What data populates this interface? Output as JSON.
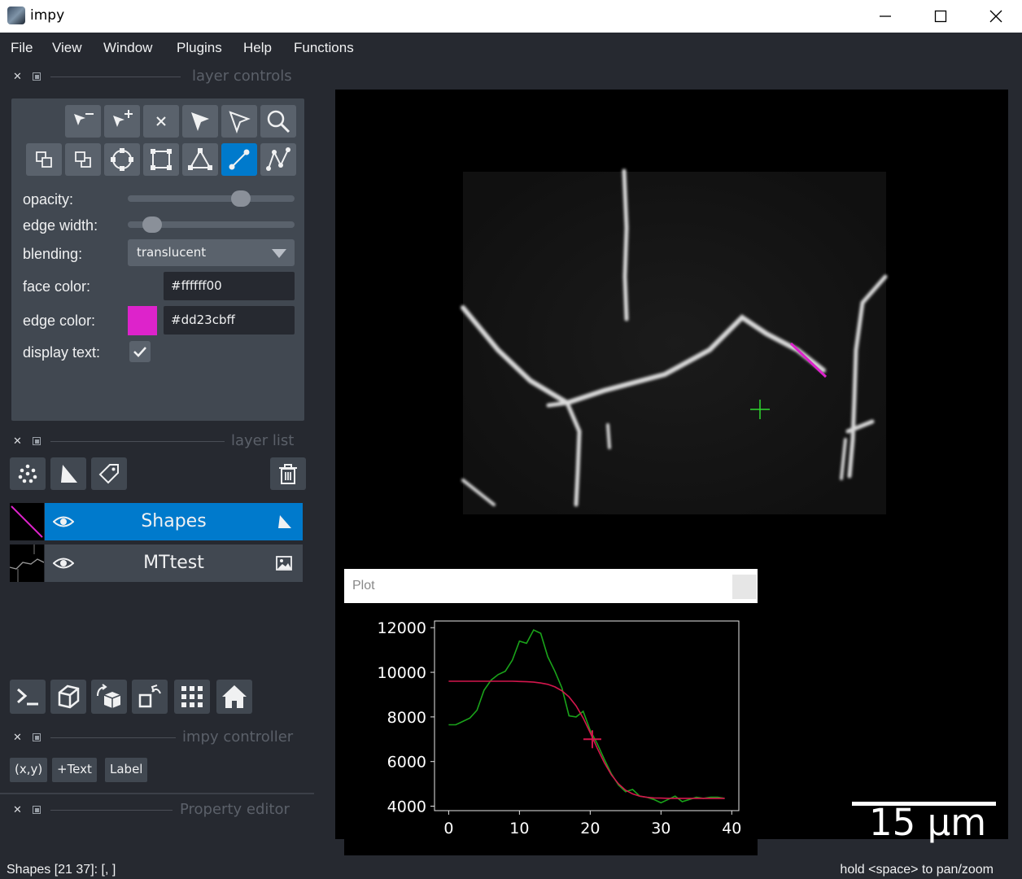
{
  "window": {
    "title": "impy"
  },
  "menu": [
    "File",
    "View",
    "Window",
    "Plugins",
    "Help",
    "Functions"
  ],
  "docks": {
    "layer_controls": "layer controls",
    "layer_list": "layer list",
    "impy_controller": "impy controller",
    "property_editor": "Property editor"
  },
  "controls": {
    "opacity_label": "opacity:",
    "opacity_value": 0.7,
    "edge_width_label": "edge width:",
    "edge_width_value": 0.1,
    "blending_label": "blending:",
    "blending_value": "translucent",
    "face_color_label": "face color:",
    "face_color_value": "#ffffff00",
    "edge_color_label": "edge color:",
    "edge_color_value": "#dd23cbff",
    "edge_color_swatch": "#dd23cb",
    "display_text_label": "display text:",
    "display_text_checked": true,
    "active_tool": "line-icon"
  },
  "layers": [
    {
      "name": "Shapes",
      "selected": true,
      "visible": true,
      "type": "shapes"
    },
    {
      "name": "MTtest",
      "selected": false,
      "visible": true,
      "type": "image"
    }
  ],
  "controller_buttons": [
    "(x,y)",
    "+Text",
    "Label"
  ],
  "scalebar": {
    "label": "15 µm"
  },
  "plot": {
    "title": "Plot",
    "chart_data": {
      "type": "line",
      "xlim": [
        -2,
        41
      ],
      "ylim": [
        3800,
        12300
      ],
      "xticks": [
        0,
        10,
        20,
        30,
        40
      ],
      "yticks": [
        4000,
        6000,
        8000,
        10000,
        12000
      ],
      "xtick_labels": [
        "0",
        "10",
        "20",
        "30",
        "40"
      ],
      "ytick_labels": [
        "4000",
        "6000",
        "8000",
        "10000",
        "12000"
      ],
      "series": [
        {
          "color": "#1aa31a",
          "x": [
            0,
            1,
            2,
            3,
            4,
            5,
            6,
            7,
            8,
            9,
            10,
            11,
            12,
            13,
            14,
            15,
            16,
            17,
            18,
            19,
            20,
            21,
            22,
            23,
            24,
            25,
            26,
            27,
            28,
            29,
            30,
            31,
            32,
            33,
            34,
            35,
            36,
            37,
            38,
            39
          ],
          "y": [
            7650,
            7650,
            7800,
            7950,
            8300,
            9200,
            9650,
            9900,
            10050,
            10550,
            11400,
            11300,
            11900,
            11750,
            10700,
            10050,
            9300,
            8050,
            8000,
            8250,
            7400,
            6800,
            6100,
            5450,
            4950,
            4650,
            4750,
            4450,
            4400,
            4300,
            4150,
            4300,
            4450,
            4200,
            4300,
            4400,
            4350,
            4400,
            4400,
            4350
          ]
        },
        {
          "color": "#d3164d",
          "x": [
            0,
            1,
            2,
            3,
            4,
            5,
            6,
            7,
            8,
            9,
            10,
            11,
            12,
            13,
            14,
            15,
            16,
            17,
            18,
            19,
            20,
            21,
            22,
            23,
            24,
            25,
            26,
            27,
            28,
            29,
            30,
            31,
            32,
            33,
            34,
            35,
            36,
            37,
            38,
            39
          ],
          "y": [
            9600,
            9600,
            9600,
            9600,
            9600,
            9600,
            9600,
            9600,
            9600,
            9600,
            9590,
            9580,
            9560,
            9520,
            9460,
            9350,
            9170,
            8900,
            8500,
            7950,
            7300,
            6600,
            5950,
            5400,
            5000,
            4720,
            4550,
            4450,
            4400,
            4370,
            4360,
            4350,
            4350,
            4350,
            4350,
            4350,
            4350,
            4350,
            4350,
            4350
          ]
        }
      ],
      "marker": {
        "x": 20.3,
        "y": 7000,
        "color": "#d3164d"
      }
    }
  },
  "status": {
    "left": "Shapes [21 37]: [, ]",
    "right": "hold <space> to pan/zoom"
  }
}
